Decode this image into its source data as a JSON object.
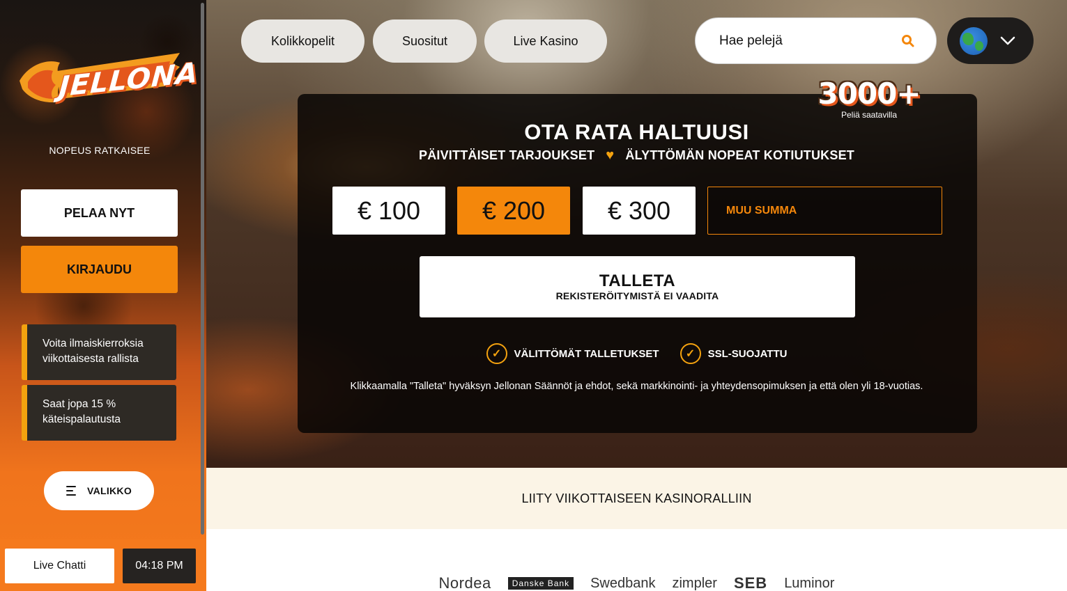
{
  "sidebar": {
    "logo_text": "JELLONA",
    "tagline": "NOPEUS RATKAISEE",
    "play_label": "PELAA NYT",
    "login_label": "KIRJAUDU",
    "promos": [
      {
        "line1": "Voita ilmaiskierroksia",
        "line2": "viikottaisesta rallista"
      },
      {
        "line1": "Saat jopa 15 %",
        "line2": "käteispalautusta"
      }
    ],
    "menu_label": "VALIKKO",
    "chat_label": "Live Chatti",
    "clock": "04:18 PM"
  },
  "nav": {
    "tabs": [
      {
        "label": "Kolikkopelit"
      },
      {
        "label": "Suositut"
      },
      {
        "label": "Live Kasino"
      }
    ],
    "search_placeholder": "Hae pelejä"
  },
  "hero": {
    "badge_number": "3000+",
    "badge_sub": "Peliä saatavilla",
    "headline": "OTA RATA HALTUUSI",
    "subline_left": "PÄIVITTÄISET TARJOUKSET",
    "subline_right": "ÄLYTTÖMÄN NOPEAT KOTIUTUKSET",
    "amounts": [
      "€ 100",
      "€ 200",
      "€ 300"
    ],
    "selected_amount": "€ 200",
    "other_placeholder": "MUU SUMMA",
    "deposit_label": "TALLETA",
    "deposit_sub": "REKISTERÖITYMISTÄ EI VAADITA",
    "features": [
      "VÄLITTÖMÄT TALLETUKSET",
      "SSL-SUOJATTU"
    ],
    "terms": "Klikkaamalla \"Talleta\" hyväksyn Jellonan Säännöt ja ehdot, sekä markkinointi- ja yhteydensopimuksen ja että olen yli 18-vuotias."
  },
  "rally": {
    "text": "LIITY VIIKOTTAISEEN KASINORALLIIN"
  },
  "banks": {
    "nordea": "Nordea",
    "danske": "Danske Bank",
    "swedbank": "Swedbank",
    "zimpler": "zimpler",
    "seb": "SEB",
    "luminor": "Luminor"
  },
  "colors": {
    "accent_orange": "#f4870b",
    "check_yellow": "#f4a20f"
  }
}
